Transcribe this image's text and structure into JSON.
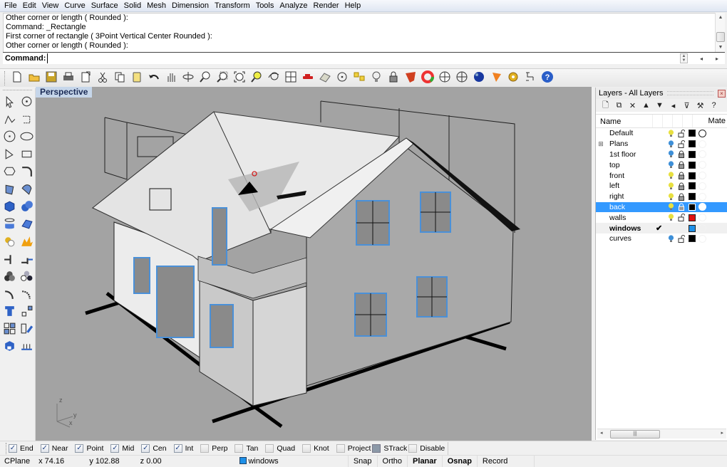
{
  "menubar": {
    "items": [
      "File",
      "Edit",
      "View",
      "Curve",
      "Surface",
      "Solid",
      "Mesh",
      "Dimension",
      "Transform",
      "Tools",
      "Analyze",
      "Render",
      "Help"
    ]
  },
  "command_history": {
    "lines": [
      "Other corner or length ( Rounded ):",
      "Command: _Rectangle",
      "First corner of rectangle ( 3Point  Vertical  Center  Rounded ):",
      "Other corner or length ( Rounded ):"
    ]
  },
  "command_line": {
    "label": "Command:",
    "value": "",
    "placeholder": ""
  },
  "toolbar": {
    "buttons": [
      "new-icon",
      "open-icon",
      "save-icon",
      "print-icon",
      "import-icon",
      "cut-icon",
      "copy-icon",
      "paste-icon",
      "undo-icon",
      "pan-icon",
      "rotate-view-icon",
      "zoom-dynamic-icon",
      "zoom-window-icon",
      "zoom-extents-icon",
      "zoom-selected-icon",
      "undo-view-icon",
      "four-viewports-icon",
      "car-icon",
      "grid-mesh-icon",
      "point-icon",
      "select-objects-icon",
      "light-bulb-icon",
      "lock-icon",
      "shaded-display-icon",
      "color-wheel-icon",
      "wireframe-sphere-icon",
      "ghosted-sphere-icon",
      "rendered-sphere-icon",
      "render-icon",
      "options-gears-icon",
      "layout-icon",
      "help-icon"
    ]
  },
  "left_tools": {
    "buttons": [
      "select-arrow-icon",
      "point-icon",
      "polyline-icon",
      "curve-cv-icon",
      "circle-icon",
      "ellipse-icon",
      "arc-icon",
      "rectangle-icon",
      "polygon-icon",
      "fillet-curve-icon",
      "surface-corner-icon",
      "surface-edge-icon",
      "box-solid-icon",
      "sphere-solid-icon",
      "cylinder-icon",
      "mesh-icon",
      "boolean-union-icon",
      "explode-icon",
      "split-icon",
      "trim-icon",
      "boolean-difference-icon",
      "boolean-split-icon",
      "fillet-icon",
      "chamfer-icon",
      "text-icon",
      "scale-icon",
      "array-icon",
      "mirror-icon",
      "render-solid-icon",
      "dimension-icon"
    ]
  },
  "viewport": {
    "title": "Perspective",
    "axis": {
      "z": "z",
      "y": "y",
      "x": "x"
    },
    "background": "#a3a3a3"
  },
  "layers_panel": {
    "title": "Layers - All Layers",
    "toolbar": [
      "new-layer-icon",
      "new-sublayer-icon",
      "delete-icon",
      "move-up-icon",
      "move-down-icon",
      "move-left-icon",
      "filter-icon",
      "tools-icon",
      "help-icon"
    ],
    "toolbar_glyphs": [
      "🗋",
      "⧉",
      "✕",
      "▲",
      "▼",
      "◂",
      "⊽",
      "⚒",
      "?"
    ],
    "columns": {
      "name": "Name",
      "material": "Mate"
    },
    "rows": [
      {
        "name": "Default",
        "expandable": false,
        "current": false,
        "on": true,
        "bulb": "#e8e040",
        "locked": false,
        "color": "#000000",
        "material": "outlined"
      },
      {
        "name": "Plans",
        "expandable": true,
        "current": false,
        "on": true,
        "bulb": "#3d8fd8",
        "locked": false,
        "color": "#000000",
        "material": "none"
      },
      {
        "name": "1st floor",
        "expandable": false,
        "current": false,
        "on": true,
        "bulb": "#3d8fd8",
        "locked": true,
        "color": "#000000",
        "material": "none"
      },
      {
        "name": "top",
        "expandable": false,
        "current": false,
        "on": true,
        "bulb": "#3d8fd8",
        "locked": true,
        "color": "#000000",
        "material": "none"
      },
      {
        "name": "front",
        "expandable": false,
        "current": false,
        "on": true,
        "bulb": "#e8e040",
        "locked": true,
        "color": "#000000",
        "material": "none"
      },
      {
        "name": "left",
        "expandable": false,
        "current": false,
        "on": true,
        "bulb": "#e8e040",
        "locked": true,
        "color": "#000000",
        "material": "none"
      },
      {
        "name": "right",
        "expandable": false,
        "current": false,
        "on": true,
        "bulb": "#e8e040",
        "locked": true,
        "color": "#000000",
        "material": "none"
      },
      {
        "name": "back",
        "expandable": false,
        "current": false,
        "selected": true,
        "on": true,
        "bulb": "#e8e040",
        "locked": true,
        "color": "#000000",
        "material": "white"
      },
      {
        "name": "walls",
        "expandable": false,
        "current": false,
        "on": true,
        "bulb": "#e8e040",
        "locked": false,
        "color": "#e01010",
        "material": "none"
      },
      {
        "name": "windows",
        "expandable": false,
        "current": true,
        "on": true,
        "bulb": "",
        "locked": null,
        "color": "#1e90e8",
        "material": "none"
      },
      {
        "name": "curves",
        "expandable": false,
        "current": false,
        "on": true,
        "bulb": "#3d8fd8",
        "locked": false,
        "color": "#000000",
        "material": "none"
      }
    ]
  },
  "osnap": {
    "items": [
      {
        "label": "End",
        "checked": true
      },
      {
        "label": "Near",
        "checked": true
      },
      {
        "label": "Point",
        "checked": true
      },
      {
        "label": "Mid",
        "checked": true
      },
      {
        "label": "Cen",
        "checked": true
      },
      {
        "label": "Int",
        "checked": true
      },
      {
        "label": "Perp",
        "checked": false
      },
      {
        "label": "Tan",
        "checked": false
      },
      {
        "label": "Quad",
        "checked": false
      },
      {
        "label": "Knot",
        "checked": false
      },
      {
        "label": "Project",
        "checked": false
      },
      {
        "label": "STrack",
        "checked": false,
        "filled": true
      },
      {
        "label": "Disable",
        "checked": false
      }
    ]
  },
  "statusbar": {
    "cplane": "CPlane",
    "x": "x 74.16",
    "y": "y 102.88",
    "z": "z 0.00",
    "current_layer": "windows",
    "current_layer_color": "#1e90e8",
    "panes": [
      {
        "label": "Snap",
        "bold": false
      },
      {
        "label": "Ortho",
        "bold": false
      },
      {
        "label": "Planar",
        "bold": true
      },
      {
        "label": "Osnap",
        "bold": true
      },
      {
        "label": "Record History",
        "bold": false
      }
    ]
  }
}
